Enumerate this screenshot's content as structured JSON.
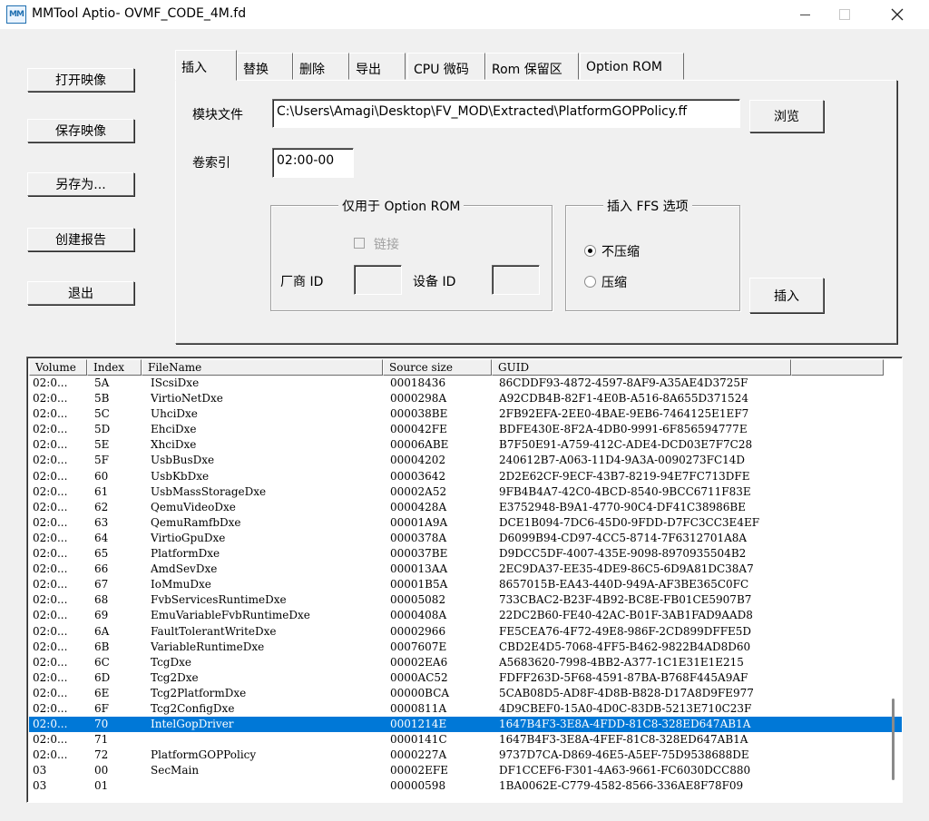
{
  "window": {
    "title": "MMTool Aptio- OVMF_CODE_4M.fd",
    "icon_text": "MM"
  },
  "left_buttons": {
    "open": "打开映像",
    "save": "保存映像",
    "save_as": "另存为...",
    "report": "创建报告",
    "exit": "退出"
  },
  "tabs": [
    "插入",
    "替换",
    "删除",
    "导出",
    "CPU 微码",
    "Rom 保留区",
    "Option ROM"
  ],
  "insert": {
    "module_file_label": "模块文件",
    "module_file_value": "C:\\Users\\Amagi\\Desktop\\FV_MOD\\Extracted\\PlatformGOPPolicy.ff",
    "browse_label": "浏览",
    "volume_index_label": "卷索引",
    "volume_index_value": "02:00-00",
    "option_rom_group": "仅用于 Option ROM",
    "link_label": "链接",
    "vendor_id_label": "厂商 ID",
    "device_id_label": "设备 ID",
    "ffs_group": "插入 FFS 选项",
    "uncompressed_label": "不压缩",
    "compressed_label": "压缩",
    "insert_button": "插入"
  },
  "table": {
    "columns": [
      "Volume",
      "Index",
      "FileName",
      "Source size",
      "GUID"
    ],
    "rows": [
      [
        "02:0...",
        "5A",
        "IScsiDxe",
        "00018436",
        "86CDDF93-4872-4597-8AF9-A35AE4D3725F"
      ],
      [
        "02:0...",
        "5B",
        "VirtioNetDxe",
        "0000298A",
        "A92CDB4B-82F1-4E0B-A516-8A655D371524"
      ],
      [
        "02:0...",
        "5C",
        "UhciDxe",
        "000038BE",
        "2FB92EFA-2EE0-4BAE-9EB6-7464125E1EF7"
      ],
      [
        "02:0...",
        "5D",
        "EhciDxe",
        "000042FE",
        "BDFE430E-8F2A-4DB0-9991-6F856594777E"
      ],
      [
        "02:0...",
        "5E",
        "XhciDxe",
        "00006ABE",
        "B7F50E91-A759-412C-ADE4-DCD03E7F7C28"
      ],
      [
        "02:0...",
        "5F",
        "UsbBusDxe",
        "00004202",
        "240612B7-A063-11D4-9A3A-0090273FC14D"
      ],
      [
        "02:0...",
        "60",
        "UsbKbDxe",
        "00003642",
        "2D2E62CF-9ECF-43B7-8219-94E7FC713DFE"
      ],
      [
        "02:0...",
        "61",
        "UsbMassStorageDxe",
        "00002A52",
        "9FB4B4A7-42C0-4BCD-8540-9BCC6711F83E"
      ],
      [
        "02:0...",
        "62",
        "QemuVideoDxe",
        "0000428A",
        "E3752948-B9A1-4770-90C4-DF41C38986BE"
      ],
      [
        "02:0...",
        "63",
        "QemuRamfbDxe",
        "00001A9A",
        "DCE1B094-7DC6-45D0-9FDD-D7FC3CC3E4EF"
      ],
      [
        "02:0...",
        "64",
        "VirtioGpuDxe",
        "0000378A",
        "D6099B94-CD97-4CC5-8714-7F6312701A8A"
      ],
      [
        "02:0...",
        "65",
        "PlatformDxe",
        "000037BE",
        "D9DCC5DF-4007-435E-9098-8970935504B2"
      ],
      [
        "02:0...",
        "66",
        "AmdSevDxe",
        "000013AA",
        "2EC9DA37-EE35-4DE9-86C5-6D9A81DC38A7"
      ],
      [
        "02:0...",
        "67",
        "IoMmuDxe",
        "00001B5A",
        "8657015B-EA43-440D-949A-AF3BE365C0FC"
      ],
      [
        "02:0...",
        "68",
        "FvbServicesRuntimeDxe",
        "00005082",
        "733CBAC2-B23F-4B92-BC8E-FB01CE5907B7"
      ],
      [
        "02:0...",
        "69",
        "EmuVariableFvbRuntimeDxe",
        "0000408A",
        "22DC2B60-FE40-42AC-B01F-3AB1FAD9AAD8"
      ],
      [
        "02:0...",
        "6A",
        "FaultTolerantWriteDxe",
        "00002966",
        "FE5CEA76-4F72-49E8-986F-2CD899DFFE5D"
      ],
      [
        "02:0...",
        "6B",
        "VariableRuntimeDxe",
        "0007607E",
        "CBD2E4D5-7068-4FF5-B462-9822B4AD8D60"
      ],
      [
        "02:0...",
        "6C",
        "TcgDxe",
        "00002EA6",
        "A5683620-7998-4BB2-A377-1C1E31E1E215"
      ],
      [
        "02:0...",
        "6D",
        "Tcg2Dxe",
        "0000AC52",
        "FDFF263D-5F68-4591-87BA-B768F445A9AF"
      ],
      [
        "02:0...",
        "6E",
        "Tcg2PlatformDxe",
        "00000BCA",
        "5CAB08D5-AD8F-4D8B-B828-D17A8D9FE977"
      ],
      [
        "02:0...",
        "6F",
        "Tcg2ConfigDxe",
        "0000811A",
        "4D9CBEF0-15A0-4D0C-83DB-5213E710C23F"
      ],
      [
        "02:0...",
        "70",
        "IntelGopDriver",
        "0001214E",
        "1647B4F3-3E8A-4FDD-81C8-328ED647AB1A"
      ],
      [
        "02:0...",
        "71",
        "",
        "0000141C",
        "1647B4F3-3E8A-4FEF-81C8-328ED647AB1A"
      ],
      [
        "02:0...",
        "72",
        "PlatformGOPPolicy",
        "0000227A",
        "9737D7CA-D869-46E5-A5EF-75D9538688DE"
      ],
      [
        "03",
        "00",
        "SecMain",
        "00002EFE",
        "DF1CCEF6-F301-4A63-9661-FC6030DCC880"
      ],
      [
        "03",
        "01",
        "",
        "00000598",
        "1BA0062E-C779-4582-8566-336AE8F78F09"
      ]
    ],
    "selected_index": 22,
    "selection_color": "#0078d7"
  },
  "icons": {
    "close": "close-icon",
    "minimize": "minimize-icon",
    "maximize": "maximize-icon",
    "app": "mmtool-app-icon"
  }
}
